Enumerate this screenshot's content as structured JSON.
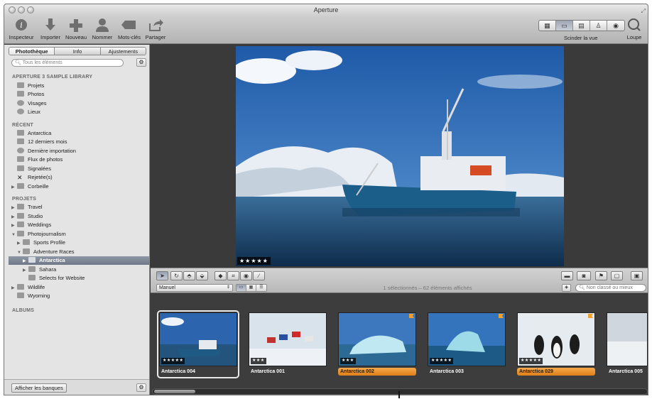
{
  "window": {
    "title": "Aperture"
  },
  "toolbar": {
    "buttons": [
      {
        "label": "Inspecteur",
        "icon": "info-icon"
      },
      {
        "label": "Importer",
        "icon": "import-arrow-icon"
      },
      {
        "label": "Nouveau",
        "icon": "plus-icon"
      },
      {
        "label": "Nommer",
        "icon": "person-icon"
      },
      {
        "label": "Mots-clés",
        "icon": "tag-icon"
      },
      {
        "label": "Partager",
        "icon": "share-icon"
      }
    ],
    "view_label": "Scinder la vue",
    "loupe_label": "Loupe"
  },
  "sidebar": {
    "tabs": [
      "Photothèque",
      "Info",
      "Ajustements"
    ],
    "search_placeholder": "Tous les éléments",
    "library_title": "APERTURE 3 SAMPLE LIBRARY",
    "library_items": [
      "Projets",
      "Photos",
      "Visages",
      "Lieux"
    ],
    "recent_title": "RÉCENT",
    "recent_items": [
      "Antarctica",
      "12 derniers mois",
      "Dernière importation",
      "Flux de photos",
      "Signalées",
      "Rejetée(s)",
      "Corbeille"
    ],
    "projects_title": "PROJETS",
    "project_items": [
      "Travel",
      "Studio",
      "Weddings",
      "Photojournalism",
      "Sports Profile",
      "Adventure Races",
      "Antarctica",
      "Sahara",
      "Selects for Website",
      "Wildlife",
      "Wyoming"
    ],
    "albums_title": "ALBUMS",
    "footer_button": "Afficher les banques"
  },
  "viewer": {
    "stars": "★★★★★"
  },
  "controls": {
    "sort": "Manuel",
    "status": "1 sélectionnés – 62 éléments affichés",
    "filter_placeholder": "Non classé ou mieux"
  },
  "thumbnails": [
    {
      "caption": "Antarctica 004",
      "stars": "★★★★★",
      "flagged": false,
      "selected": true
    },
    {
      "caption": "Antarctica 001",
      "stars": "★★★",
      "flagged": false,
      "selected": false
    },
    {
      "caption": "Antarctica 002",
      "stars": "★★★",
      "flagged": true,
      "selected": false
    },
    {
      "caption": "Antarctica 003",
      "stars": "★★★★★",
      "flagged": true,
      "selected": false
    },
    {
      "caption": "Antarctica 029",
      "stars": "★★★★★",
      "flagged": true,
      "selected": false
    },
    {
      "caption": "Antarctica 005",
      "stars": "",
      "flagged": false,
      "selected": false
    }
  ],
  "colors": {
    "selection": "#7a8494",
    "highlight_orange": "#e8902a",
    "viewer_bg": "#3a3a3a"
  }
}
